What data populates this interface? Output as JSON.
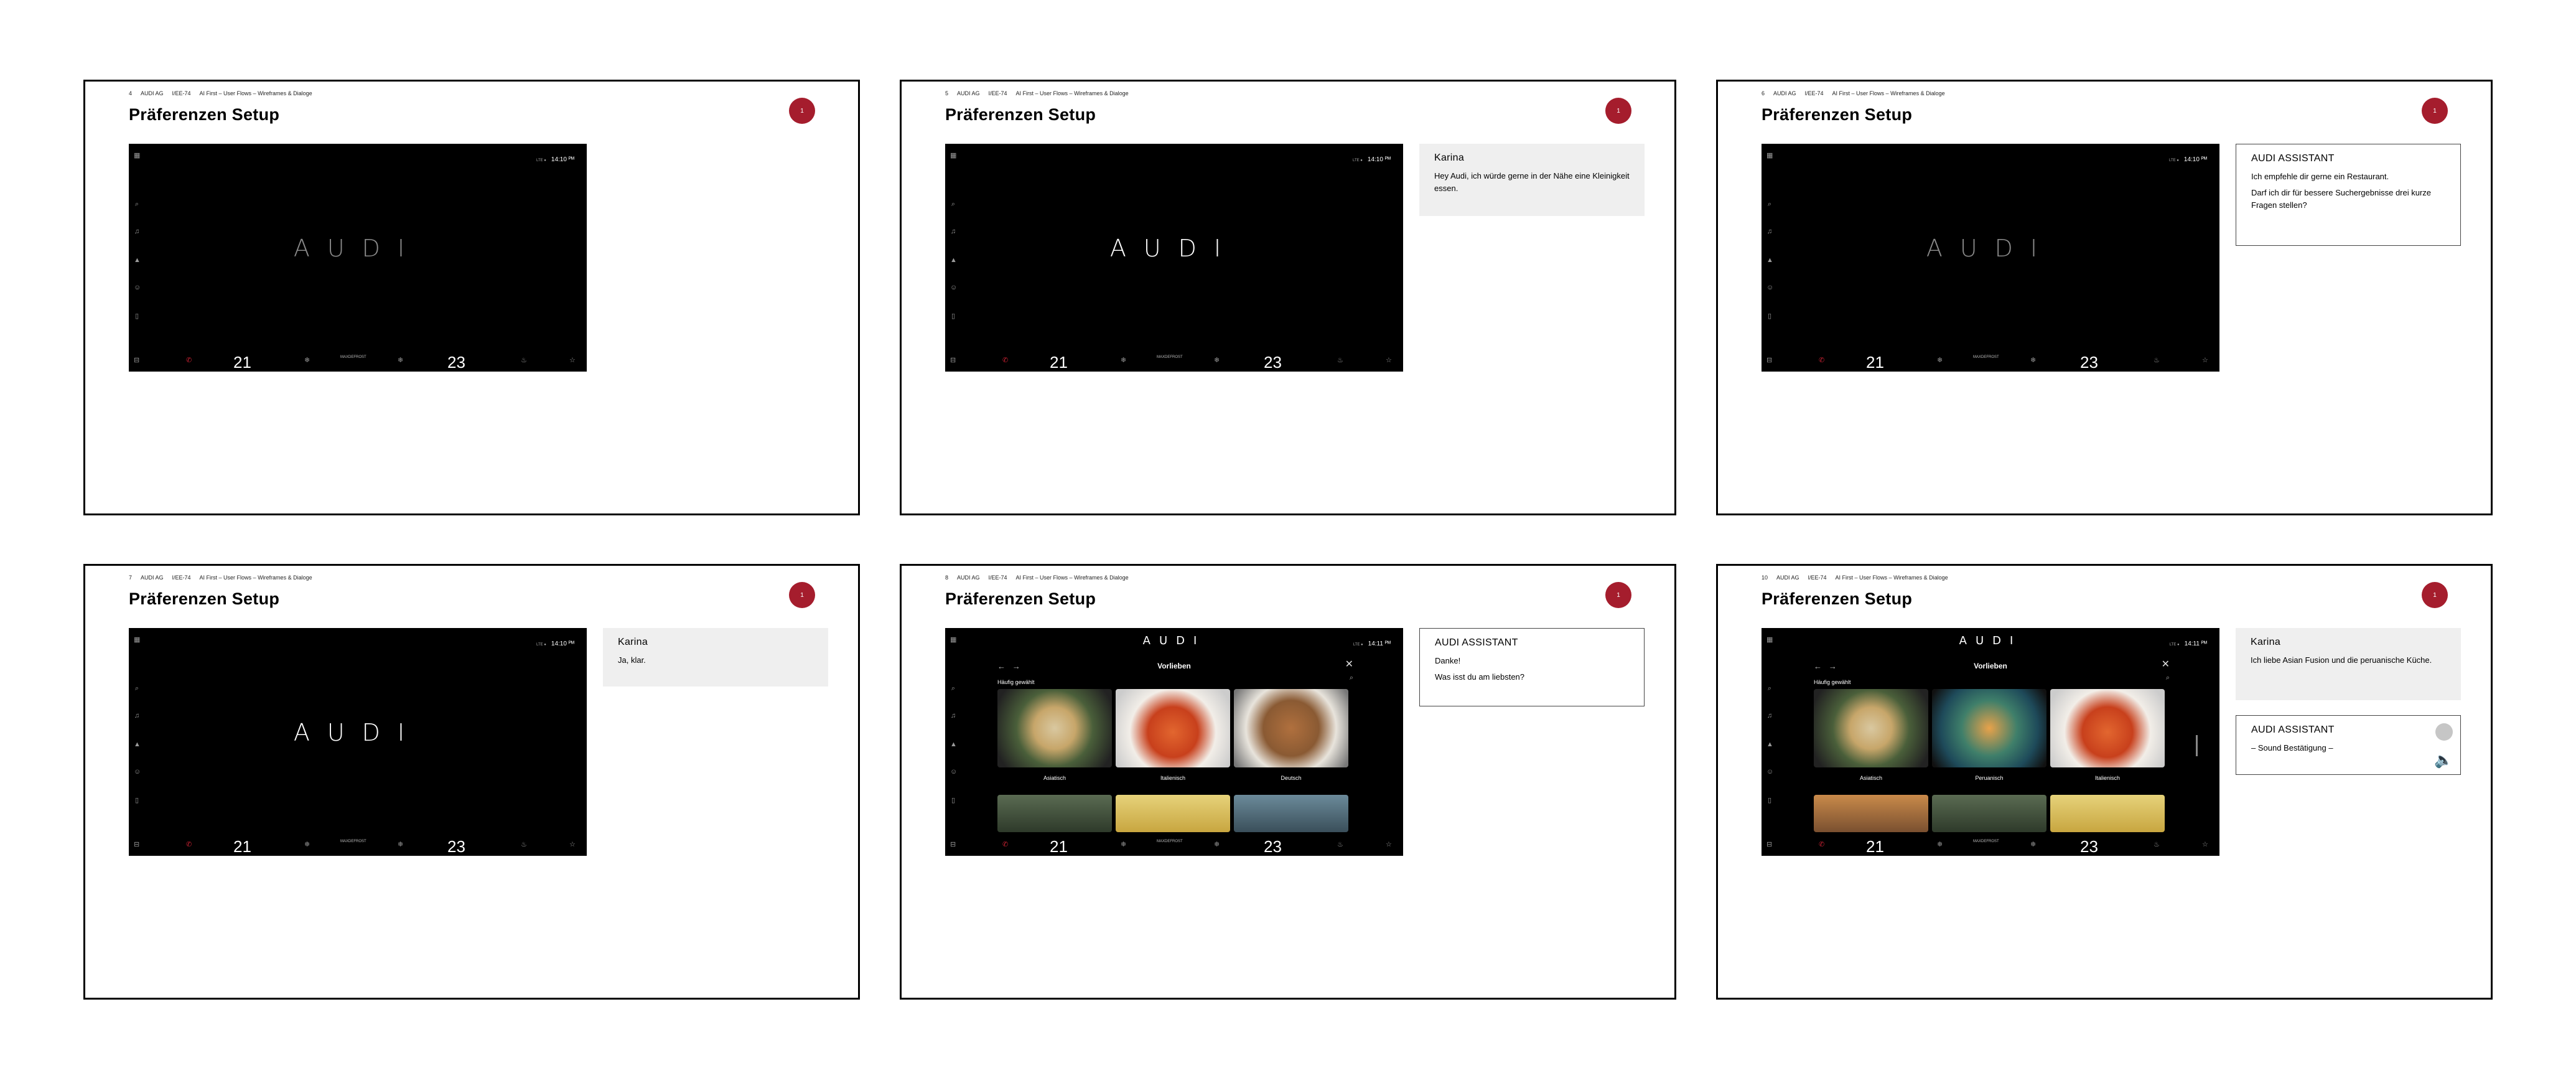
{
  "common": {
    "company": "AUDI AG",
    "dept": "I/EE-74",
    "project": "AI First – User Flows – Wireframes & Dialoge",
    "title": "Präferenzen Setup",
    "badge": "1",
    "status_small": "LTE ●",
    "climate": {
      "left_temp": "21",
      "right_temp": "23",
      "center": "MAXDEFROST"
    },
    "logo_text": "AUDI"
  },
  "slides": [
    {
      "page": "4",
      "time": "14:10 ᴾᴹ"
    },
    {
      "page": "5",
      "time": "14:10 ᴾᴹ",
      "bubble": {
        "kind": "user",
        "who": "Karina",
        "msg": "Hey Audi, ich würde gerne in der Nähe eine Kleinigkeit essen."
      }
    },
    {
      "page": "6",
      "time": "14:10 ᴾᴹ",
      "bubble": {
        "kind": "asst",
        "who": "AUDI ASSISTANT",
        "msg": "Ich empfehle dir gerne ein Restaurant.",
        "msg2": "Darf ich dir für bessere Suchergebnisse drei kurze Fragen stellen?"
      }
    },
    {
      "page": "7",
      "time": "14:10 ᴾᴹ",
      "bubble": {
        "kind": "user",
        "who": "Karina",
        "msg": "Ja, klar."
      }
    },
    {
      "page": "8",
      "time": "14:11 ᴾᴹ",
      "app": {
        "title": "Vorlieben",
        "section": "Häufig gewählt",
        "labels": [
          "Asiatisch",
          "Italienisch",
          "Deutsch"
        ]
      },
      "bubble": {
        "kind": "asst",
        "who": "AUDI ASSISTANT",
        "msg": "Danke!",
        "msg2": "Was isst du am liebsten?"
      }
    },
    {
      "page": "10",
      "time": "14:11 ᴾᴹ",
      "app": {
        "title": "Vorlieben",
        "section": "Häufig gewählt",
        "labels": [
          "Asiatisch",
          "Peruanisch",
          "Italienisch"
        ]
      },
      "bubble": {
        "kind": "user",
        "who": "Karina",
        "msg": "Ich liebe Asian Fusion und die peruanische Küche."
      },
      "bubble2": {
        "who": "AUDI ASSISTANT",
        "msg": "– Sound Bestätigung –"
      }
    }
  ],
  "colors": {
    "badge": "#a51d2d",
    "screen": "#000000",
    "user_bubble": "#efefef"
  }
}
